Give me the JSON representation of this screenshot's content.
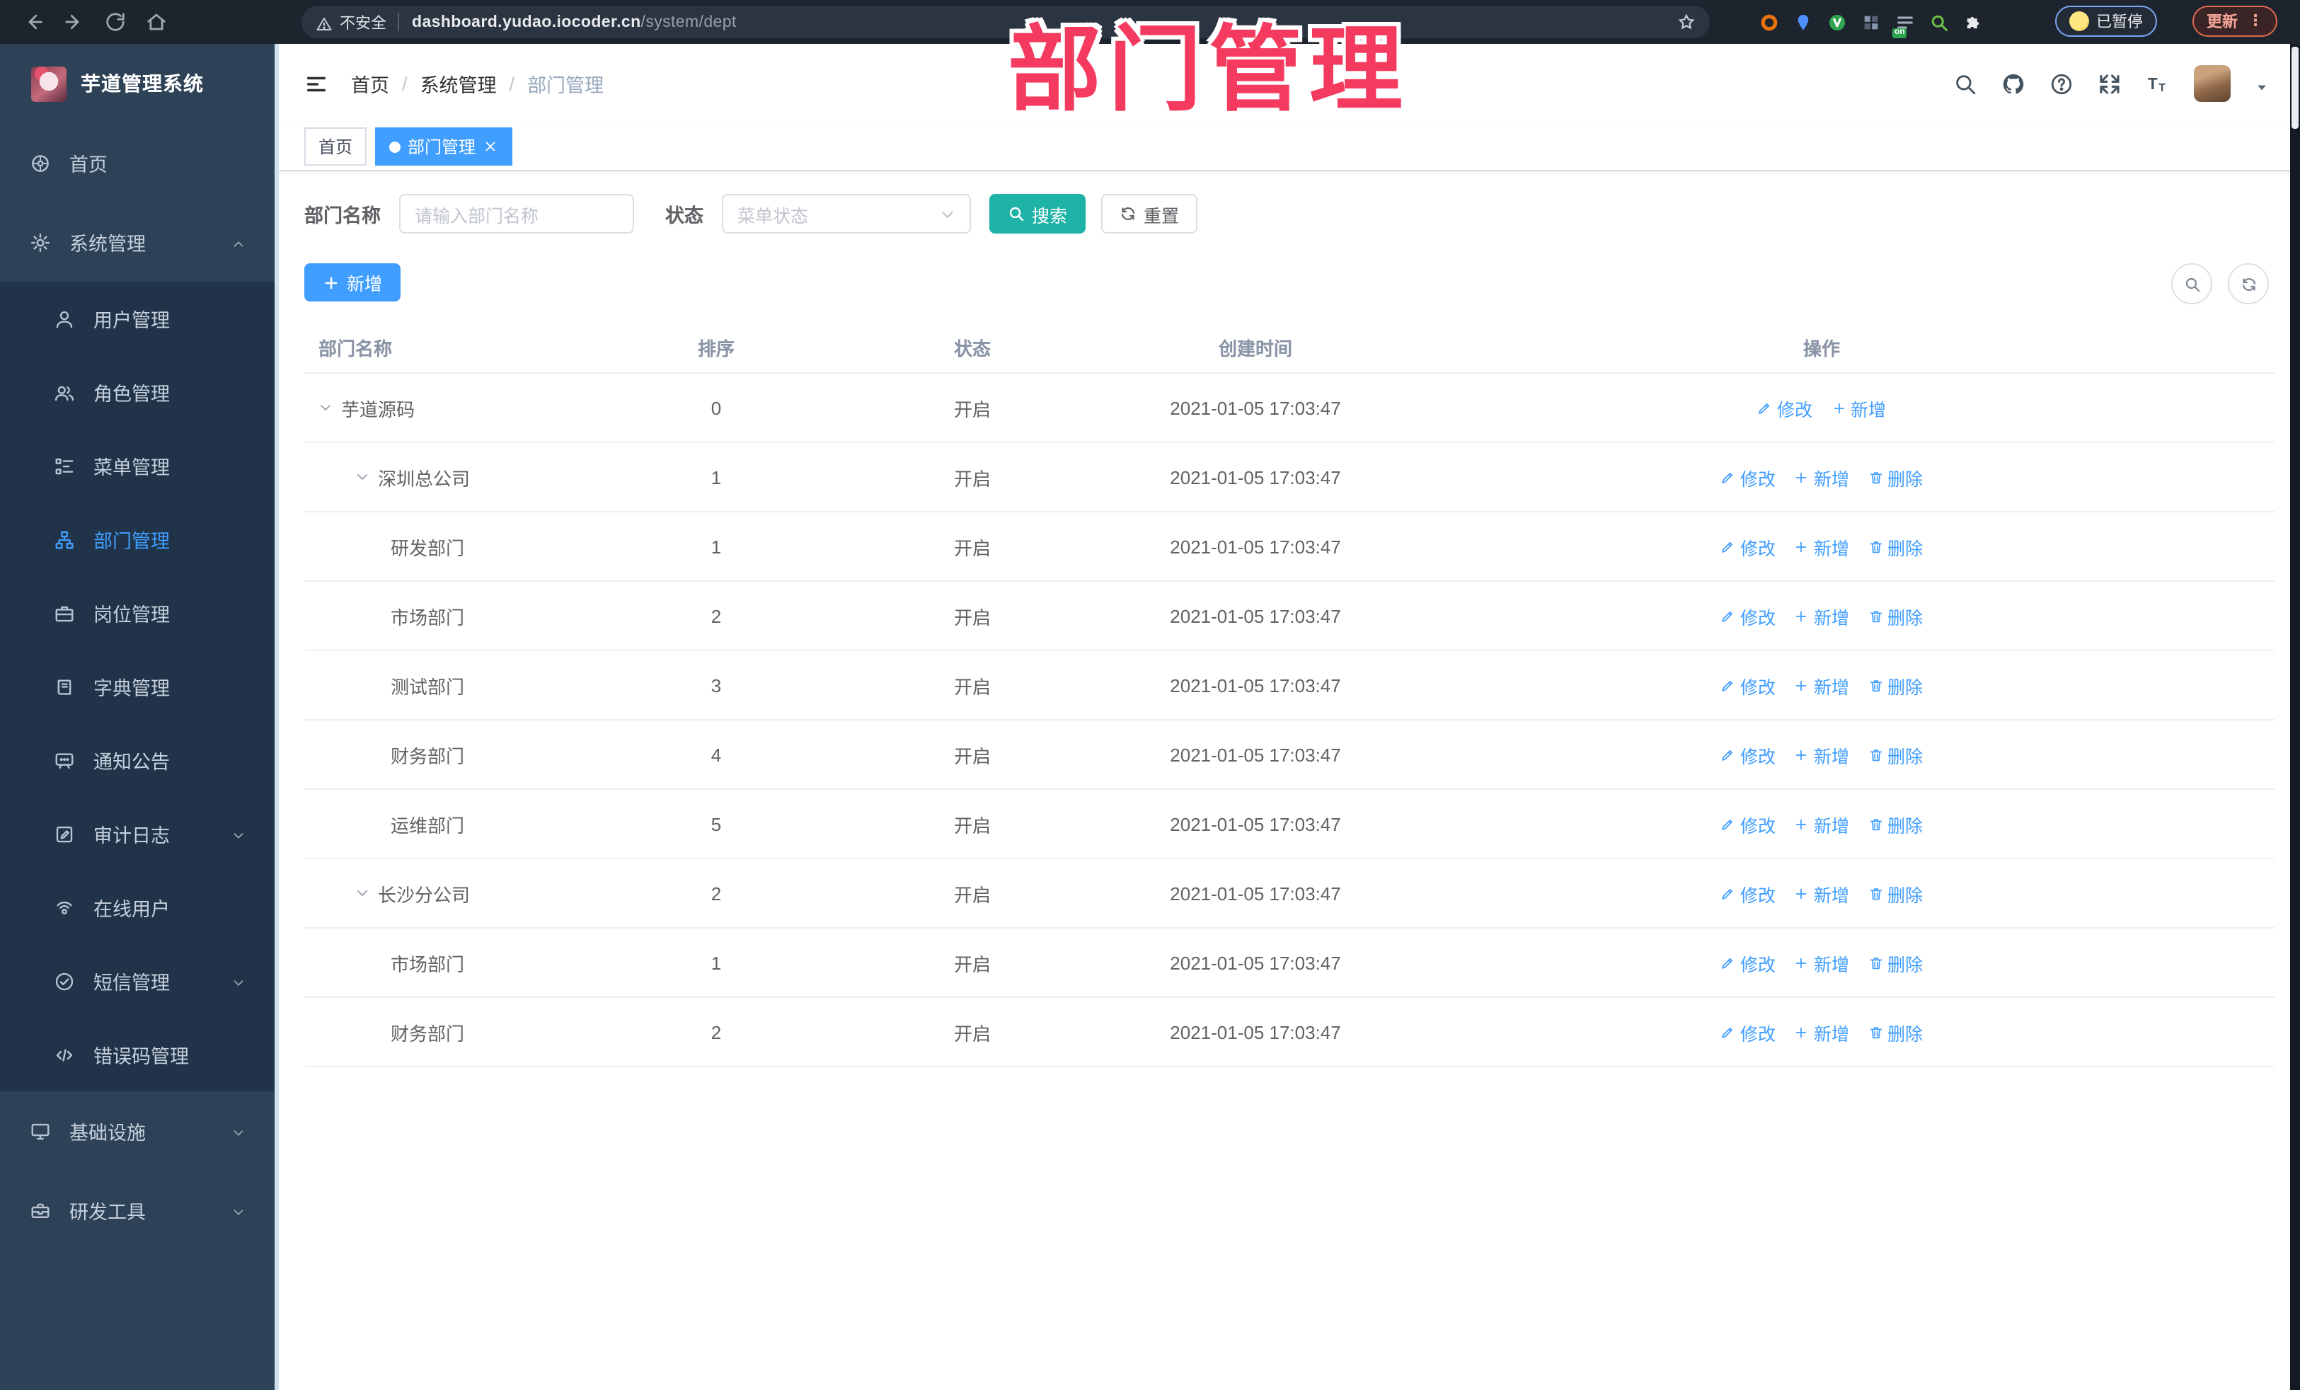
{
  "colors": {
    "accent": "#409eff",
    "search_teal": "#1fb2a6",
    "watermark_pink": "#f43b5f",
    "sidebar_bg": "#2d4257",
    "submenu_bg": "#203349"
  },
  "browser": {
    "security_label": "不安全",
    "url_host": "dashboard.yudao.iocoder.cn",
    "url_path": "/system/dept",
    "paused_button": "已暂停",
    "update_button": "更新",
    "extensions": [
      {
        "name": "shield-extension-icon",
        "icon": "ring",
        "color": "#e8710a"
      },
      {
        "name": "pin-extension-icon",
        "icon": "pin",
        "color": "#4d90fe"
      },
      {
        "name": "v-extension-icon",
        "icon": "vcircle",
        "color": "#2ea44f"
      },
      {
        "name": "grid-extension-icon",
        "icon": "grid",
        "color": "#8596ad"
      },
      {
        "name": "list-extension-icon",
        "icon": "listlines",
        "color": "#aab2bd",
        "badge": "on"
      },
      {
        "name": "magnifier-extension-icon",
        "icon": "magnify-green",
        "color": "#6abf45"
      },
      {
        "name": "puzzle-extension-icon",
        "icon": "puzzle",
        "color": "#e8eaed"
      }
    ]
  },
  "sidebar": {
    "logo_title": "芋道管理系统",
    "menu": [
      {
        "label": "首页",
        "icon": "dashboard-icon",
        "glyph": "dashboard",
        "type": "top"
      },
      {
        "label": "系统管理",
        "icon": "gear-icon",
        "glyph": "gear",
        "type": "top",
        "chevron": "up"
      },
      {
        "label": "用户管理",
        "icon": "user-icon",
        "glyph": "user",
        "type": "sub"
      },
      {
        "label": "角色管理",
        "icon": "users-icon",
        "glyph": "users",
        "type": "sub"
      },
      {
        "label": "菜单管理",
        "icon": "menu-tree-icon",
        "glyph": "menutree",
        "type": "sub"
      },
      {
        "label": "部门管理",
        "icon": "org-tree-icon",
        "glyph": "orgtree",
        "type": "sub",
        "active": true
      },
      {
        "label": "岗位管理",
        "icon": "briefcase-icon",
        "glyph": "briefcase",
        "type": "sub"
      },
      {
        "label": "字典管理",
        "icon": "dictionary-icon",
        "glyph": "dict",
        "type": "sub"
      },
      {
        "label": "通知公告",
        "icon": "announcement-icon",
        "glyph": "announce",
        "type": "sub"
      },
      {
        "label": "审计日志",
        "icon": "audit-log-icon",
        "glyph": "auditlog",
        "type": "sub",
        "chevron": "down"
      },
      {
        "label": "在线用户",
        "icon": "online-user-icon",
        "glyph": "online",
        "type": "sub"
      },
      {
        "label": "短信管理",
        "icon": "sms-icon",
        "glyph": "smscheck",
        "type": "sub",
        "chevron": "down"
      },
      {
        "label": "错误码管理",
        "icon": "code-icon",
        "glyph": "code",
        "type": "sub"
      },
      {
        "label": "基础设施",
        "icon": "monitor-icon",
        "glyph": "monitor",
        "type": "top",
        "chevron": "down"
      },
      {
        "label": "研发工具",
        "icon": "toolbox-icon",
        "glyph": "toolbox",
        "type": "top",
        "chevron": "down"
      }
    ]
  },
  "navbar": {
    "breadcrumb": [
      "首页",
      "系统管理",
      "部门管理"
    ]
  },
  "tags": [
    {
      "label": "首页",
      "active": false,
      "closable": false
    },
    {
      "label": "部门管理",
      "active": true,
      "closable": true
    }
  ],
  "watermark": "部门管理",
  "filters": {
    "name_label": "部门名称",
    "name_placeholder": "请输入部门名称",
    "status_label": "状态",
    "status_placeholder": "菜单状态",
    "search_button": "搜索",
    "reset_button": "重置"
  },
  "toolbar": {
    "add_button": "新增"
  },
  "table": {
    "columns": [
      "部门名称",
      "排序",
      "状态",
      "创建时间",
      "操作"
    ],
    "rows": [
      {
        "name": "芋道源码",
        "level": 0,
        "expanded": true,
        "sort": "0",
        "status": "开启",
        "created": "2021-01-05 17:03:47",
        "actions": [
          {
            "label": "修改",
            "icon": "edit-pencil-icon",
            "glyph": "pencil"
          },
          {
            "label": "新增",
            "icon": "plus-icon",
            "glyph": "plus"
          }
        ]
      },
      {
        "name": "深圳总公司",
        "level": 1,
        "expanded": true,
        "sort": "1",
        "status": "开启",
        "created": "2021-01-05 17:03:47",
        "actions": [
          {
            "label": "修改",
            "icon": "edit-pencil-icon",
            "glyph": "pencil"
          },
          {
            "label": "新增",
            "icon": "plus-icon",
            "glyph": "plus"
          },
          {
            "label": "删除",
            "icon": "delete-trash-icon",
            "glyph": "trash"
          }
        ]
      },
      {
        "name": "研发部门",
        "level": 2,
        "expanded": false,
        "sort": "1",
        "status": "开启",
        "created": "2021-01-05 17:03:47",
        "actions": [
          {
            "label": "修改",
            "icon": "edit-pencil-icon",
            "glyph": "pencil"
          },
          {
            "label": "新增",
            "icon": "plus-icon",
            "glyph": "plus"
          },
          {
            "label": "删除",
            "icon": "delete-trash-icon",
            "glyph": "trash"
          }
        ]
      },
      {
        "name": "市场部门",
        "level": 2,
        "expanded": false,
        "sort": "2",
        "status": "开启",
        "created": "2021-01-05 17:03:47",
        "actions": [
          {
            "label": "修改",
            "icon": "edit-pencil-icon",
            "glyph": "pencil"
          },
          {
            "label": "新增",
            "icon": "plus-icon",
            "glyph": "plus"
          },
          {
            "label": "删除",
            "icon": "delete-trash-icon",
            "glyph": "trash"
          }
        ]
      },
      {
        "name": "测试部门",
        "level": 2,
        "expanded": false,
        "sort": "3",
        "status": "开启",
        "created": "2021-01-05 17:03:47",
        "actions": [
          {
            "label": "修改",
            "icon": "edit-pencil-icon",
            "glyph": "pencil"
          },
          {
            "label": "新增",
            "icon": "plus-icon",
            "glyph": "plus"
          },
          {
            "label": "删除",
            "icon": "delete-trash-icon",
            "glyph": "trash"
          }
        ]
      },
      {
        "name": "财务部门",
        "level": 2,
        "expanded": false,
        "sort": "4",
        "status": "开启",
        "created": "2021-01-05 17:03:47",
        "actions": [
          {
            "label": "修改",
            "icon": "edit-pencil-icon",
            "glyph": "pencil"
          },
          {
            "label": "新增",
            "icon": "plus-icon",
            "glyph": "plus"
          },
          {
            "label": "删除",
            "icon": "delete-trash-icon",
            "glyph": "trash"
          }
        ]
      },
      {
        "name": "运维部门",
        "level": 2,
        "expanded": false,
        "sort": "5",
        "status": "开启",
        "created": "2021-01-05 17:03:47",
        "actions": [
          {
            "label": "修改",
            "icon": "edit-pencil-icon",
            "glyph": "pencil"
          },
          {
            "label": "新增",
            "icon": "plus-icon",
            "glyph": "plus"
          },
          {
            "label": "删除",
            "icon": "delete-trash-icon",
            "glyph": "trash"
          }
        ]
      },
      {
        "name": "长沙分公司",
        "level": 1,
        "expanded": true,
        "sort": "2",
        "status": "开启",
        "created": "2021-01-05 17:03:47",
        "actions": [
          {
            "label": "修改",
            "icon": "edit-pencil-icon",
            "glyph": "pencil"
          },
          {
            "label": "新增",
            "icon": "plus-icon",
            "glyph": "plus"
          },
          {
            "label": "删除",
            "icon": "delete-trash-icon",
            "glyph": "trash"
          }
        ]
      },
      {
        "name": "市场部门",
        "level": 2,
        "expanded": false,
        "sort": "1",
        "status": "开启",
        "created": "2021-01-05 17:03:47",
        "actions": [
          {
            "label": "修改",
            "icon": "edit-pencil-icon",
            "glyph": "pencil"
          },
          {
            "label": "新增",
            "icon": "plus-icon",
            "glyph": "plus"
          },
          {
            "label": "删除",
            "icon": "delete-trash-icon",
            "glyph": "trash"
          }
        ]
      },
      {
        "name": "财务部门",
        "level": 2,
        "expanded": false,
        "sort": "2",
        "status": "开启",
        "created": "2021-01-05 17:03:47",
        "actions": [
          {
            "label": "修改",
            "icon": "edit-pencil-icon",
            "glyph": "pencil"
          },
          {
            "label": "新增",
            "icon": "plus-icon",
            "glyph": "plus"
          },
          {
            "label": "删除",
            "icon": "delete-trash-icon",
            "glyph": "trash"
          }
        ]
      }
    ]
  }
}
